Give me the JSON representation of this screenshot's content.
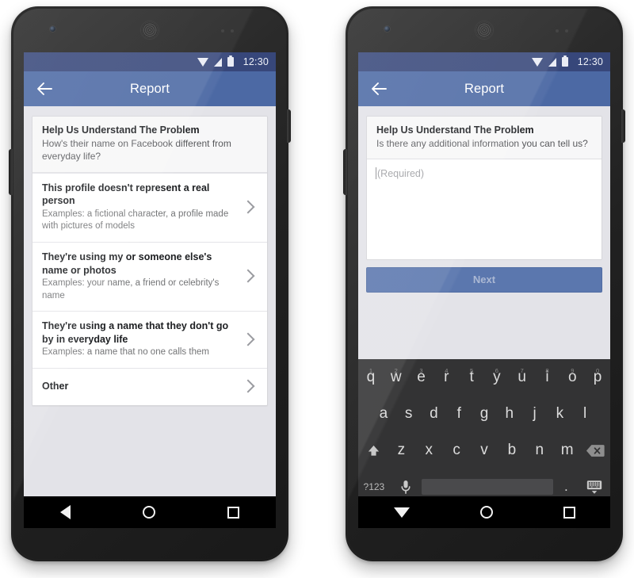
{
  "statusbar": {
    "time": "12:30",
    "icons": [
      "wifi-icon",
      "cellular-signal-icon",
      "battery-icon"
    ]
  },
  "appbar": {
    "title": "Report",
    "back_icon": "back-arrow-icon"
  },
  "left_phone": {
    "header_card": {
      "title": "Help Us Understand The Problem",
      "subtitle": "How's their name on Facebook different from everyday life?"
    },
    "options": [
      {
        "title": "This profile doesn't represent a real person",
        "subtitle": "Examples: a fictional character, a profile made with pictures of models"
      },
      {
        "title": "They're using my or someone else's name or photos",
        "subtitle": "Examples: your name, a friend or celebrity's name"
      },
      {
        "title": "They're using a name that they don't go by in everyday life",
        "subtitle": "Examples: a name that no one calls them"
      },
      {
        "title": "Other",
        "subtitle": ""
      }
    ],
    "navbar": [
      "back-triangle-icon",
      "home-circle-icon",
      "recents-square-icon"
    ]
  },
  "right_phone": {
    "header_card": {
      "title": "Help Us Understand The Problem",
      "subtitle": "Is there any additional information you can tell us?"
    },
    "textarea": {
      "value": "",
      "placeholder": "(Required)"
    },
    "next_button": {
      "label": "Next"
    },
    "keyboard": {
      "row1": [
        {
          "key": "q",
          "hint": "1"
        },
        {
          "key": "w",
          "hint": "2"
        },
        {
          "key": "e",
          "hint": "3"
        },
        {
          "key": "r",
          "hint": "4"
        },
        {
          "key": "t",
          "hint": "5"
        },
        {
          "key": "y",
          "hint": "6"
        },
        {
          "key": "u",
          "hint": "7"
        },
        {
          "key": "i",
          "hint": "8"
        },
        {
          "key": "o",
          "hint": "9"
        },
        {
          "key": "p",
          "hint": "0"
        }
      ],
      "row2": [
        "a",
        "s",
        "d",
        "f",
        "g",
        "h",
        "j",
        "k",
        "l"
      ],
      "row3": [
        "z",
        "x",
        "c",
        "v",
        "b",
        "n",
        "m"
      ],
      "shift_icon": "shift-icon",
      "backspace_icon": "backspace-icon",
      "symbols_label": "?123",
      "mic_icon": "microphone-icon",
      "period_label": ".",
      "hide_keyboard_icon": "hide-keyboard-icon"
    },
    "navbar": [
      "back-down-triangle-icon",
      "home-circle-icon",
      "recents-square-icon"
    ]
  },
  "colors": {
    "facebook_blue": "#4c69a4",
    "statusbar_blue": "#37477a",
    "screen_bg": "#e3e3e8",
    "next_button": "#5b77ae",
    "keyboard_bg": "#333334"
  }
}
